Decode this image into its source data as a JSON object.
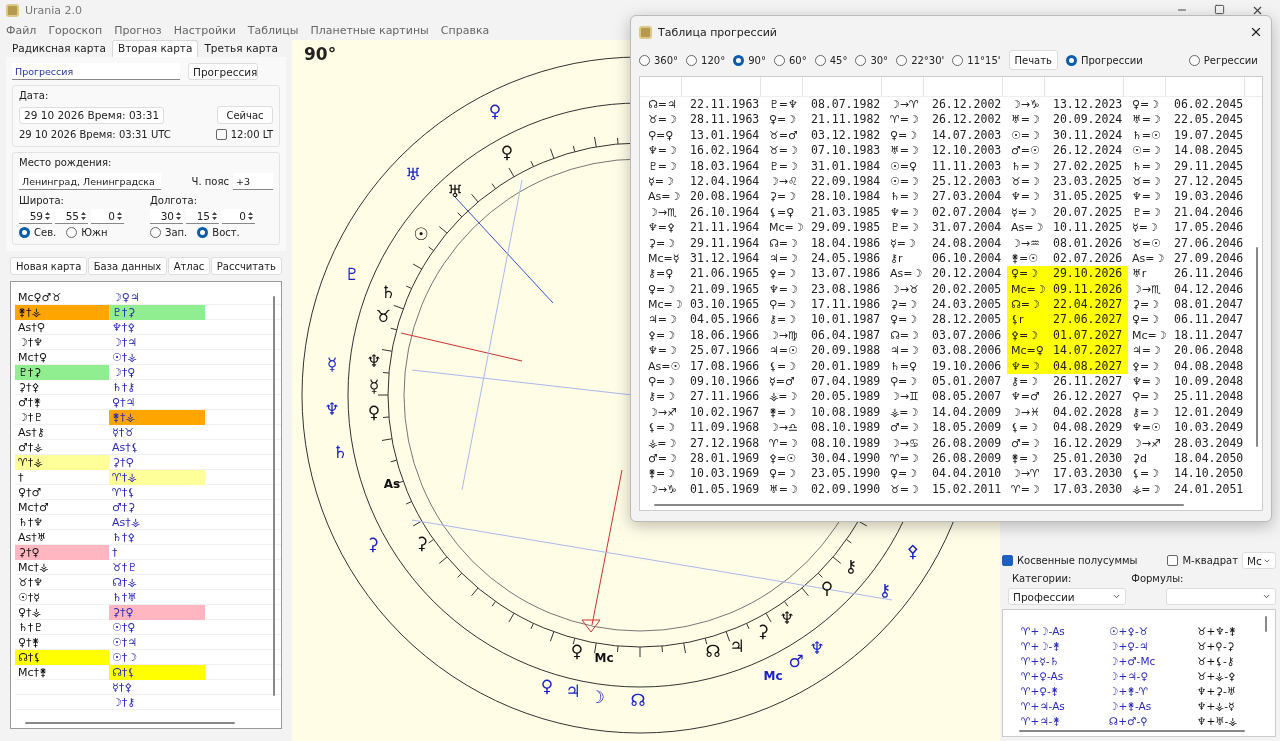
{
  "window": {
    "title": "Urania 2.0"
  },
  "menu": [
    "Файл",
    "Гороскоп",
    "Прогноз",
    "Настройки",
    "Таблицы",
    "Планетные картины",
    "Справка"
  ],
  "tabs": [
    {
      "label": "Радиксная карта",
      "selected": false
    },
    {
      "label": "Вторая карта",
      "selected": true
    },
    {
      "label": "Третья карта",
      "selected": false
    }
  ],
  "form": {
    "name_value": "Прогрессия",
    "type_select": "Прогрессия",
    "date_label": "Дата:",
    "date_value": "29 10 2026 Время: 03:31",
    "now_button": "Сейчас",
    "utc_text": "29 10 2026 Время: 03:31 UTC",
    "lt_checkbox": {
      "label": "12:00 LT",
      "checked": false
    },
    "place_label": "Место рождения:",
    "place_value": "Ленинград, Ленинградска",
    "tz_label": "Ч. пояс",
    "tz_value": "+3",
    "lat_label": "Широта:",
    "lat": [
      "59",
      "55",
      "0"
    ],
    "lat_dirs": [
      {
        "label": "Сев.",
        "selected": true
      },
      {
        "label": "Южн",
        "selected": false
      }
    ],
    "lon_label": "Долгота:",
    "lon": [
      "30",
      "15",
      "0"
    ],
    "lon_dirs": [
      {
        "label": "Зап.",
        "selected": false
      },
      {
        "label": "Вост.",
        "selected": true
      }
    ]
  },
  "actions": [
    "Новая карта",
    "База данных",
    "Атлас",
    "Рассчитать"
  ],
  "pairs": [
    {
      "left": {
        "text": "Mc♀♂♉"
      },
      "right": {
        "text": "☽♀♃"
      }
    },
    {
      "left": {
        "text": "⚵†⚶",
        "color": "#ffa500"
      },
      "right": {
        "text": "♇†⚳",
        "color": "#90ee90"
      }
    },
    {
      "left": {
        "text": "As†⚲"
      },
      "right": {
        "text": "♆†⚴"
      }
    },
    {
      "left": {
        "text": "☽†♆"
      },
      "right": {
        "text": "☽†♃"
      }
    },
    {
      "left": {
        "text": "Mc†♀"
      },
      "right": {
        "text": "☉†⚶"
      }
    },
    {
      "left": {
        "text": "♇†⚳",
        "color": "#90ee90"
      },
      "right": {
        "text": "☽†♀"
      }
    },
    {
      "left": {
        "text": "⚳†⚴"
      },
      "right": {
        "text": "♄†⚷"
      }
    },
    {
      "left": {
        "text": "♂†⚵"
      },
      "right": {
        "text": "♀†♃"
      }
    },
    {
      "left": {
        "text": "☽†♇"
      },
      "right": {
        "text": "⚵†⚶",
        "color": "#ffa500"
      }
    },
    {
      "left": {
        "text": "As†⚷"
      },
      "right": {
        "text": "☿†♉"
      }
    },
    {
      "left": {
        "text": "♂†⚶"
      },
      "right": {
        "text": "As†⚸"
      }
    },
    {
      "left": {
        "text": "♈†⚶",
        "color": "#ffff99"
      },
      "right": {
        "text": "⚳†⚲"
      }
    },
    {
      "left": {
        "text": "†"
      },
      "right": {
        "text": "♈†⚶",
        "color": "#ffff99"
      }
    },
    {
      "left": {
        "text": "♀†♂"
      },
      "right": {
        "text": "♈†⚸"
      }
    },
    {
      "left": {
        "text": "Mc†♂"
      },
      "right": {
        "text": "♂†⚳"
      }
    },
    {
      "left": {
        "text": "♄†♆"
      },
      "right": {
        "text": "As†⚶"
      }
    },
    {
      "left": {
        "text": "As†♅"
      },
      "right": {
        "text": "♄†⚴"
      }
    },
    {
      "left": {
        "text": "⚳†♀",
        "color": "#ffb6c1"
      },
      "right": {
        "text": "†"
      }
    },
    {
      "left": {
        "text": "Mc†⚶"
      },
      "right": {
        "text": "♉†♇"
      }
    },
    {
      "left": {
        "text": "♉†♆"
      },
      "right": {
        "text": "☊†⚶"
      }
    },
    {
      "left": {
        "text": "☉†☿"
      },
      "right": {
        "text": "♄†♅"
      }
    },
    {
      "left": {
        "text": "♀†⚶"
      },
      "right": {
        "text": "⚳†♀",
        "color": "#ffb6c1"
      }
    },
    {
      "left": {
        "text": "♄†♇"
      },
      "right": {
        "text": "☉†♀"
      }
    },
    {
      "left": {
        "text": "♀†⚵"
      },
      "right": {
        "text": "☉†♃"
      }
    },
    {
      "left": {
        "text": "☊†⚸",
        "color": "#ffff00"
      },
      "right": {
        "text": "☉†☽"
      }
    },
    {
      "left": {
        "text": "Mc†⚵"
      },
      "right": {
        "text": "☊†⚸",
        "color": "#ffff00"
      }
    },
    {
      "right": {
        "text": "☿†⚴"
      }
    },
    {
      "right": {
        "text": "☽†⚷"
      }
    }
  ],
  "chart": {
    "title": "90°",
    "glyphs": [
      {
        "glyph": "♀",
        "kind": "outer"
      },
      {
        "glyph": "♅",
        "kind": "outer"
      },
      {
        "glyph": "♇",
        "kind": "outer"
      },
      {
        "glyph": "☿",
        "kind": "outer"
      },
      {
        "glyph": "♆",
        "kind": "outer"
      },
      {
        "glyph": "♄",
        "kind": "outer"
      },
      {
        "glyph": "⚳",
        "kind": "outer"
      },
      {
        "glyph": "♀",
        "kind": "outer"
      },
      {
        "glyph": "♃",
        "kind": "outer"
      },
      {
        "glyph": "☽",
        "kind": "outer"
      },
      {
        "glyph": "☊",
        "kind": "outer"
      },
      {
        "glyph": "Mc",
        "kind": "outer"
      },
      {
        "glyph": "♂",
        "kind": "outer"
      },
      {
        "glyph": "♆",
        "kind": "outer"
      },
      {
        "glyph": "⚷",
        "kind": "outer"
      },
      {
        "glyph": "⚴",
        "kind": "outer"
      },
      {
        "glyph": "♀",
        "kind": "inner"
      },
      {
        "glyph": "♅",
        "kind": "inner"
      },
      {
        "glyph": "☉",
        "kind": "inner"
      },
      {
        "glyph": "♄",
        "kind": "inner"
      },
      {
        "glyph": "♉",
        "kind": "inner"
      },
      {
        "glyph": "♆",
        "kind": "inner"
      },
      {
        "glyph": "☿",
        "kind": "inner"
      },
      {
        "glyph": "♀",
        "kind": "inner"
      },
      {
        "glyph": "As",
        "kind": "inner"
      },
      {
        "glyph": "⚳",
        "kind": "inner"
      },
      {
        "glyph": "♀",
        "kind": "inner"
      },
      {
        "glyph": "Mc",
        "kind": "inner"
      },
      {
        "glyph": "☊",
        "kind": "inner"
      },
      {
        "glyph": "♃",
        "kind": "inner"
      },
      {
        "glyph": "⚳",
        "kind": "inner"
      },
      {
        "glyph": "♆",
        "kind": "inner"
      },
      {
        "glyph": "⚲",
        "kind": "inner"
      },
      {
        "glyph": "⚷",
        "kind": "inner"
      }
    ]
  },
  "progress_window": {
    "title": "Таблица прогрессий",
    "harmonics": [
      {
        "label": "360°",
        "selected": false
      },
      {
        "label": "120°",
        "selected": false
      },
      {
        "label": "90°",
        "selected": true
      },
      {
        "label": "60°",
        "selected": false
      },
      {
        "label": "45°",
        "selected": false
      },
      {
        "label": "30°",
        "selected": false
      },
      {
        "label": "22°30'",
        "selected": false
      },
      {
        "label": "11°15'",
        "selected": false
      }
    ],
    "print_button": "Печать",
    "directions": [
      {
        "label": "Прогрессии",
        "selected": true
      },
      {
        "label": "Регрессии",
        "selected": false
      }
    ],
    "rows": [
      {
        "cells": [
          "☊=♃",
          "22.11.1963",
          "♇=♆",
          "08.07.1982",
          "☽→♈",
          "26.12.2002",
          "☽→♑",
          "13.12.2023",
          "♀=☽",
          "06.02.2045"
        ],
        "marked": false
      },
      {
        "cells": [
          "♉=☽",
          "28.11.1963",
          "♀=☽",
          "21.11.1982",
          "♈=☽",
          "26.12.2002",
          "♅=☽",
          "20.09.2024",
          "♅=☽",
          "22.05.2045"
        ],
        "marked": false
      },
      {
        "cells": [
          "⚲=♀",
          "13.01.1964",
          "♉=♂",
          "03.12.1982",
          "♀=☽",
          "14.07.2003",
          "☉=☽",
          "30.11.2024",
          "♄=☉",
          "19.07.2045"
        ],
        "marked": false
      },
      {
        "cells": [
          "♆=☽",
          "16.02.1964",
          "♉=☽",
          "07.10.1983",
          "♅=☽",
          "12.10.2003",
          "♂=☉",
          "26.12.2024",
          "☉=☽",
          "14.08.2045"
        ],
        "marked": false
      },
      {
        "cells": [
          "♇=☽",
          "18.03.1964",
          "♇=☽",
          "31.01.1984",
          "☉=♀",
          "11.11.2003",
          "♄=☽",
          "27.02.2025",
          "♄=☽",
          "29.11.2045"
        ],
        "marked": false
      },
      {
        "cells": [
          "☿=☽",
          "12.04.1964",
          "☽→♌",
          "22.09.1984",
          "☉=☽",
          "25.12.2003",
          "♉=☽",
          "23.03.2025",
          "♉=☽",
          "27.12.2045"
        ],
        "marked": false
      },
      {
        "cells": [
          "As=☽",
          "20.08.1964",
          "⚳=☽",
          "28.10.1984",
          "♄=☽",
          "27.03.2004",
          "♆=☽",
          "31.05.2025",
          "♆=☽",
          "19.03.2046"
        ],
        "marked": false
      },
      {
        "cells": [
          "☽→♏",
          "26.10.1964",
          "⚸=♀",
          "21.03.1985",
          "♆=☽",
          "02.07.2004",
          "☿=☽",
          "20.07.2025",
          "♇=☽",
          "21.04.2046"
        ],
        "marked": false
      },
      {
        "cells": [
          "♆=⚴",
          "21.11.1964",
          "Mc=☽",
          "29.09.1985",
          "♇=☽",
          "31.07.2004",
          "As=☽",
          "10.11.2025",
          "☿=☽",
          "17.05.2046"
        ],
        "marked": false
      },
      {
        "cells": [
          "⚳=☽",
          "29.11.1964",
          "☊=☽",
          "18.04.1986",
          "☿=☽",
          "24.08.2004",
          "☽→♒",
          "08.01.2026",
          "♉=☉",
          "27.06.2046"
        ],
        "marked": false
      },
      {
        "cells": [
          "Mc=☿",
          "31.12.1964",
          "♃=☽",
          "24.05.1986",
          "⚷r",
          "06.10.2004",
          "⚵=☉",
          "02.07.2026",
          "As=☽",
          "27.09.2046"
        ],
        "marked": false
      },
      {
        "cells": [
          "⚷=♀",
          "21.06.1965",
          "⚴=☽",
          "13.07.1986",
          "As=☽",
          "20.12.2004",
          "♀=☽",
          "29.10.2026",
          "♅r",
          "26.11.2046"
        ],
        "marked": true
      },
      {
        "cells": [
          "♀=☽",
          "21.09.1965",
          "♆=☽",
          "23.08.1986",
          "☽→♉",
          "20.02.2005",
          "Mc=☽",
          "09.11.2026",
          "☽→♏",
          "04.12.2046"
        ],
        "marked": true
      },
      {
        "cells": [
          "Mc=☽",
          "03.10.1965",
          "⚲=☽",
          "17.11.1986",
          "⚳=☽",
          "24.03.2005",
          "☊=☽",
          "22.04.2027",
          "⚳=☽",
          "08.01.2047"
        ],
        "marked": true
      },
      {
        "cells": [
          "♃=☽",
          "04.05.1966",
          "⚷=☽",
          "10.01.1987",
          "♀=☽",
          "28.12.2005",
          "⚸r",
          "27.06.2027",
          "♀=☽",
          "06.11.2047"
        ],
        "marked": true
      },
      {
        "cells": [
          "⚴=☽",
          "18.06.1966",
          "☽→♍",
          "06.04.1987",
          "☊=☽",
          "03.07.2006",
          "⚴=☽",
          "01.07.2027",
          "Mc=☽",
          "18.11.2047"
        ],
        "marked": true
      },
      {
        "cells": [
          "♆=☽",
          "25.07.1966",
          "♃=☉",
          "20.09.1988",
          "♃=☽",
          "03.08.2006",
          "Mc=♀",
          "14.07.2027",
          "♃=☽",
          "20.06.2048"
        ],
        "marked": true
      },
      {
        "cells": [
          "As=☉",
          "17.08.1966",
          "⚸=☽",
          "20.01.1989",
          "♄=♀",
          "19.10.2006",
          "♆=☽",
          "04.08.2027",
          "⚴=☽",
          "04.08.2048"
        ],
        "marked": true
      },
      {
        "cells": [
          "⚲=☽",
          "09.10.1966",
          "☿=♂",
          "07.04.1989",
          "⚲=☽",
          "05.01.2007",
          "⚷=☽",
          "26.11.2027",
          "♆=☽",
          "10.09.2048"
        ],
        "marked": false
      },
      {
        "cells": [
          "⚷=☽",
          "27.11.1966",
          "⚶=☽",
          "20.05.1989",
          "☽→♊",
          "08.05.2007",
          "♆=♂",
          "26.12.2027",
          "⚲=☽",
          "25.11.2048"
        ],
        "marked": false
      },
      {
        "cells": [
          "☽→♐",
          "10.02.1967",
          "⚵=☽",
          "10.08.1989",
          "⚶=☽",
          "14.04.2009",
          "☽→♓",
          "04.02.2028",
          "⚷=☽",
          "12.01.2049"
        ],
        "marked": false
      },
      {
        "cells": [
          "⚸=☽",
          "11.09.1968",
          "☽→♎",
          "08.10.1989",
          "♂=☽",
          "18.05.2009",
          "⚸=☽",
          "04.08.2029",
          "♆=☉",
          "10.03.2049"
        ],
        "marked": false
      },
      {
        "cells": [
          "⚶=☽",
          "27.12.1968",
          "♈=☽",
          "08.10.1989",
          "☽→♋",
          "26.08.2009",
          "♂=☽",
          "16.12.2029",
          "☽→♐",
          "28.03.2049"
        ],
        "marked": false
      },
      {
        "cells": [
          "♂=☽",
          "28.01.1969",
          "⚴=☉",
          "30.04.1990",
          "♈=☽",
          "26.08.2009",
          "⚵=☽",
          "25.01.2030",
          "⚳d",
          "18.04.2050"
        ],
        "marked": false
      },
      {
        "cells": [
          "⚵=☽",
          "10.03.1969",
          "♀=☽",
          "23.05.1990",
          "♀=☽",
          "04.04.2010",
          "☽→♈",
          "17.03.2030",
          "⚸=☽",
          "14.10.2050"
        ],
        "marked": false
      },
      {
        "cells": [
          "☽→♑",
          "01.05.1969",
          "♅=☽",
          "02.09.1990",
          "♉=☽",
          "15.02.2011",
          "♈=☽",
          "17.03.2030",
          "⚶=☽",
          "24.01.2051"
        ],
        "marked": false
      }
    ]
  },
  "semisums": {
    "indirect": {
      "label": "Косвенные полусуммы",
      "checked": true
    },
    "msquare": {
      "label": "М-квадрат",
      "checked": false
    },
    "point_select": "Mc",
    "categories_label": "Категории:",
    "categories_value": "Профессии",
    "formulas_label": "Формулы:",
    "formulas": [
      [
        "♈+☽-As",
        "☉+⚴-♉",
        "♉+♆-⚵"
      ],
      [
        "♈+☽-⚵",
        "☽+♀-♃",
        "♉+⚲-⚳"
      ],
      [
        "♈+☿-♄",
        "☽+♂-Mc",
        "♉+⚸-⚷"
      ],
      [
        "♈+♀-As",
        "☽+♃-♀",
        "♉+⚶-⚴"
      ],
      [
        "♈+♀-⚵",
        "☽+⚵-♈",
        "♆+⚳-♅"
      ],
      [
        "♈+♃-As",
        "☽+⚵-As",
        "♆+⚶-☿"
      ],
      [
        "♈+♃-⚵",
        "☊+♂-⚲",
        "♆+♅-⚶"
      ]
    ]
  }
}
